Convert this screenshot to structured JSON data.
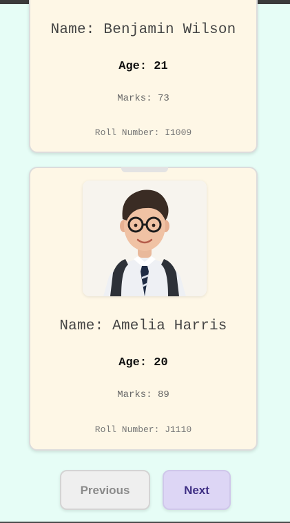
{
  "students": [
    {
      "name_text": "Name: Benjamin Wilson",
      "age_text": "Age: 21",
      "marks_text": "Marks: 73",
      "roll_text": "Roll Number: I1009"
    },
    {
      "name_text": "Name: Amelia Harris",
      "age_text": "Age: 20",
      "marks_text": "Marks: 89",
      "roll_text": "Roll Number: J1110",
      "photo_icon": "student-photo"
    }
  ],
  "pagination": {
    "previous_label": "Previous",
    "next_label": "Next"
  },
  "colors": {
    "background": "#e6fdf6",
    "card_bg": "#fef7e6",
    "next_button_bg": "#ddd6f5",
    "next_button_text": "#3f2f84",
    "previous_button_bg": "#efefef",
    "previous_button_text": "#8a8a8a"
  }
}
